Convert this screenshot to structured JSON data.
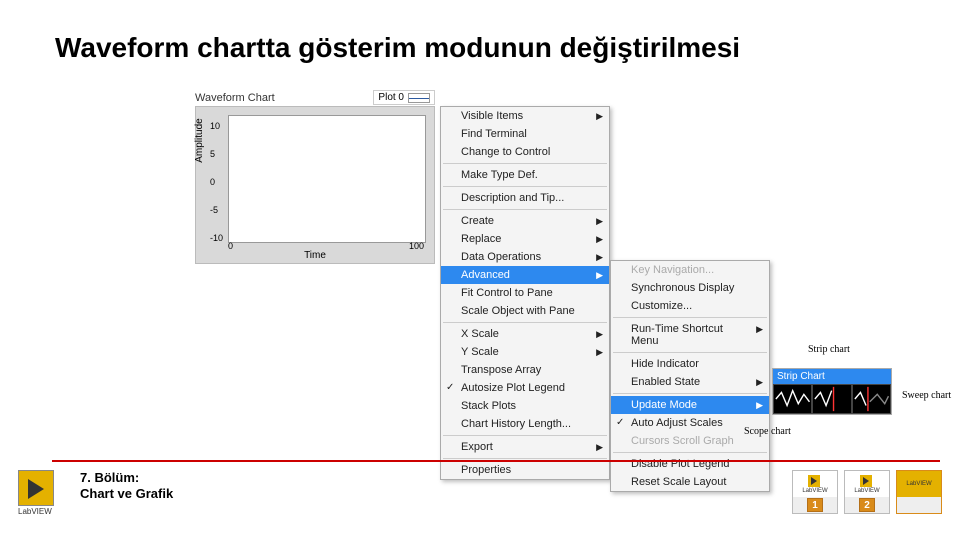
{
  "title": "Waveform chartta gösterim modunun değiştirilmesi",
  "chart": {
    "label": "Waveform Chart",
    "plot_legend": "Plot 0",
    "ylabel": "Amplitude",
    "xlabel": "Time",
    "yticks": [
      "10",
      "5",
      "0",
      "-5",
      "-10"
    ],
    "xticks": {
      "min": "0",
      "max": "100"
    }
  },
  "chart_data": {
    "type": "line",
    "title": "Waveform Chart",
    "xlabel": "Time",
    "ylabel": "Amplitude",
    "xlim": [
      0,
      100
    ],
    "ylim": [
      -10,
      10
    ],
    "series": [
      {
        "name": "Plot 0",
        "x": [],
        "y": []
      }
    ]
  },
  "menu1": {
    "items": [
      {
        "label": "Visible Items",
        "arrow": true
      },
      {
        "label": "Find Terminal"
      },
      {
        "label": "Change to Control"
      }
    ],
    "items2": [
      {
        "label": "Make Type Def."
      }
    ],
    "items3": [
      {
        "label": "Description and Tip..."
      }
    ],
    "items4": [
      {
        "label": "Create",
        "arrow": true
      },
      {
        "label": "Replace",
        "arrow": true
      },
      {
        "label": "Data Operations",
        "arrow": true
      },
      {
        "label": "Advanced",
        "arrow": true,
        "hl": true
      },
      {
        "label": "Fit Control to Pane"
      },
      {
        "label": "Scale Object with Pane"
      }
    ],
    "items5": [
      {
        "label": "X Scale",
        "arrow": true
      },
      {
        "label": "Y Scale",
        "arrow": true
      },
      {
        "label": "Transpose Array"
      },
      {
        "label": "Autosize Plot Legend",
        "check": true
      },
      {
        "label": "Stack Plots"
      },
      {
        "label": "Chart History Length..."
      }
    ],
    "items6": [
      {
        "label": "Export",
        "arrow": true
      }
    ],
    "items7": [
      {
        "label": "Properties"
      }
    ]
  },
  "menu2": {
    "items": [
      {
        "label": "Key Navigation...",
        "disabled": true
      },
      {
        "label": "Synchronous Display"
      },
      {
        "label": "Customize..."
      }
    ],
    "items2": [
      {
        "label": "Run-Time Shortcut Menu",
        "arrow": true
      }
    ],
    "items3": [
      {
        "label": "Hide Indicator"
      },
      {
        "label": "Enabled State",
        "arrow": true
      }
    ],
    "items4": [
      {
        "label": "Update Mode",
        "arrow": true,
        "hl": true
      },
      {
        "label": "Auto Adjust Scales",
        "check": true
      },
      {
        "label": "Cursors Scroll Graph",
        "disabled": true
      }
    ],
    "items5": [
      {
        "label": "Disable Plot Legend"
      },
      {
        "label": "Reset Scale Layout"
      }
    ]
  },
  "chartmode": {
    "header": "Strip Chart"
  },
  "annotations": {
    "strip": "Strip chart",
    "sweep": "Sweep chart",
    "scope": "Scope chart"
  },
  "footer": {
    "line1": "7. Bölüm:",
    "line2": "Chart ve Grafik",
    "labview": "LabVIEW"
  },
  "thumbs": {
    "lv": "LabVIEW",
    "b1": "1",
    "b2": "2"
  }
}
